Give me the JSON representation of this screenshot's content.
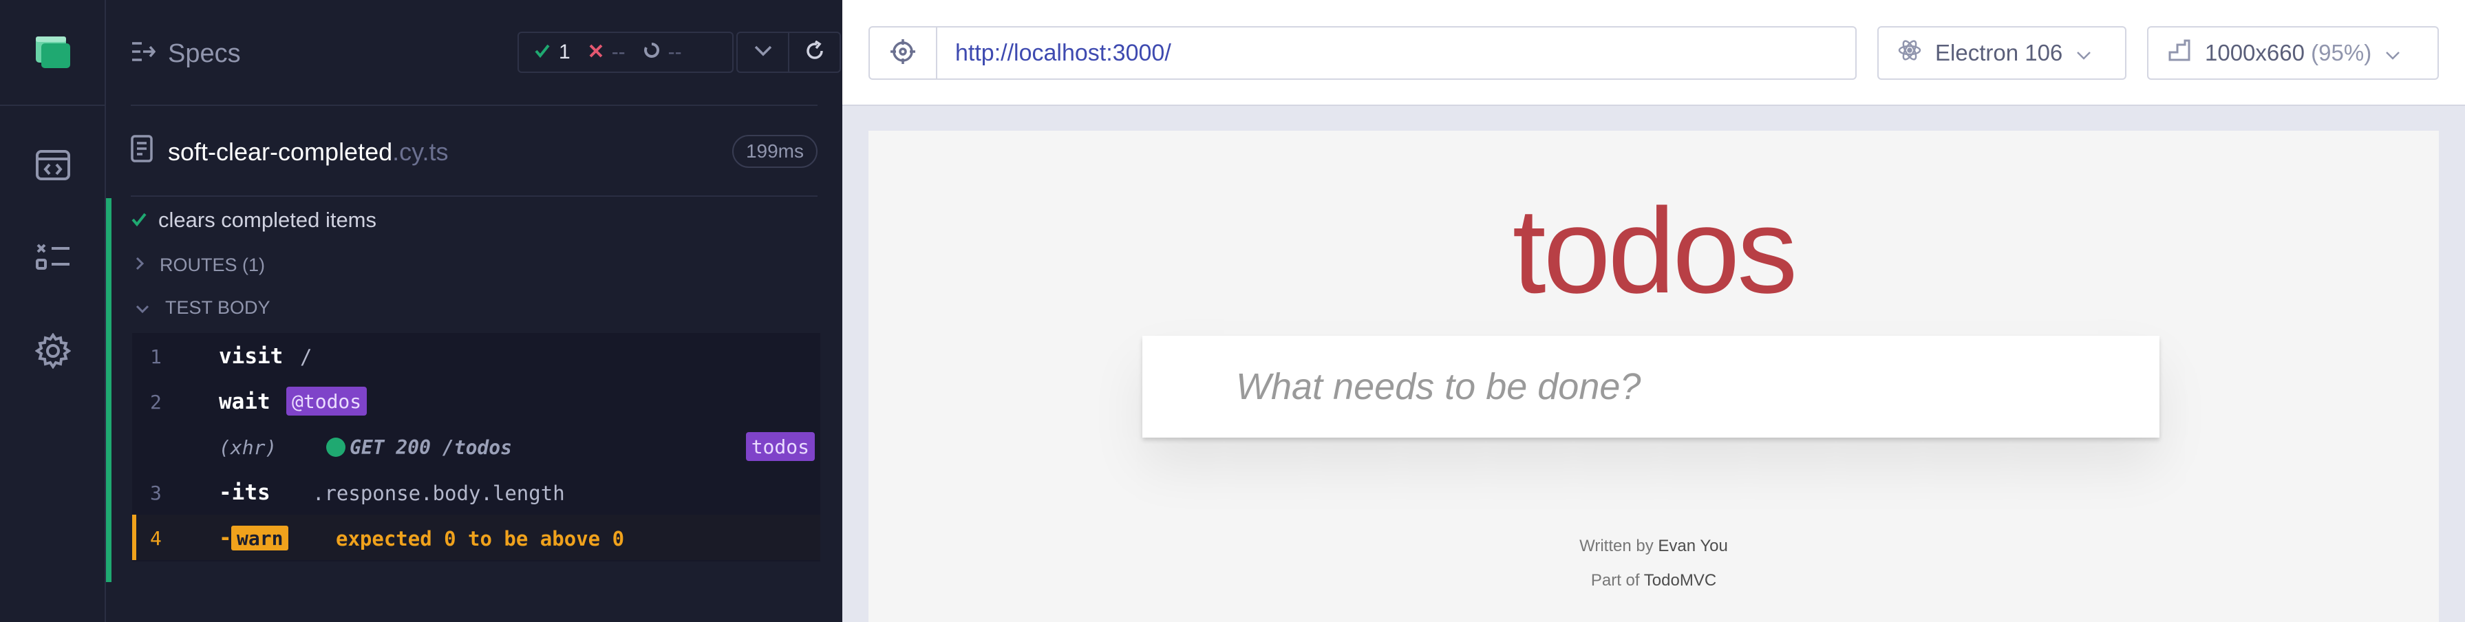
{
  "nav": {
    "icons": [
      "cypress-logo-icon",
      "runs-icon",
      "specs-list-icon",
      "settings-icon"
    ]
  },
  "reporter": {
    "specs_label": "Specs",
    "stats": {
      "passed": "1",
      "failed": "--",
      "pending": "--"
    },
    "spec_file": {
      "base": "soft-clear-completed",
      "ext": ".cy.ts",
      "duration": "199ms"
    },
    "test": {
      "title": "clears completed items",
      "routes_label": "ROUTES (1)",
      "test_body_label": "TEST BODY",
      "commands": [
        {
          "num": "1",
          "name": "visit",
          "message": "/"
        },
        {
          "num": "2",
          "name": "wait",
          "alias": "@todos"
        },
        {
          "type": "(xhr)",
          "message": "GET 200 /todos",
          "alias": "todos"
        },
        {
          "num": "3",
          "name": "-its",
          "message": ".response.body.length"
        },
        {
          "num": "4",
          "name": "-",
          "badge": "warn",
          "message": "expected 0 to be above 0"
        }
      ]
    },
    "colors": {
      "pass": "#1fa971",
      "fail": "#e45770",
      "warn": "#f0a21c",
      "alias": "#7f43c9"
    }
  },
  "aut": {
    "url": "http://localhost:3000/",
    "browser": "Electron 106",
    "viewport_size": "1000x660",
    "viewport_scale": "(95%)",
    "app": {
      "title": "todos",
      "input_placeholder": "What needs to be done?",
      "footer_written_prefix": "Written by",
      "footer_author": "Evan You",
      "footer_part_prefix": "Part of",
      "footer_project": "TodoMVC"
    },
    "colors": {
      "title": "#b83f45",
      "url": "#3e4ab0"
    }
  }
}
